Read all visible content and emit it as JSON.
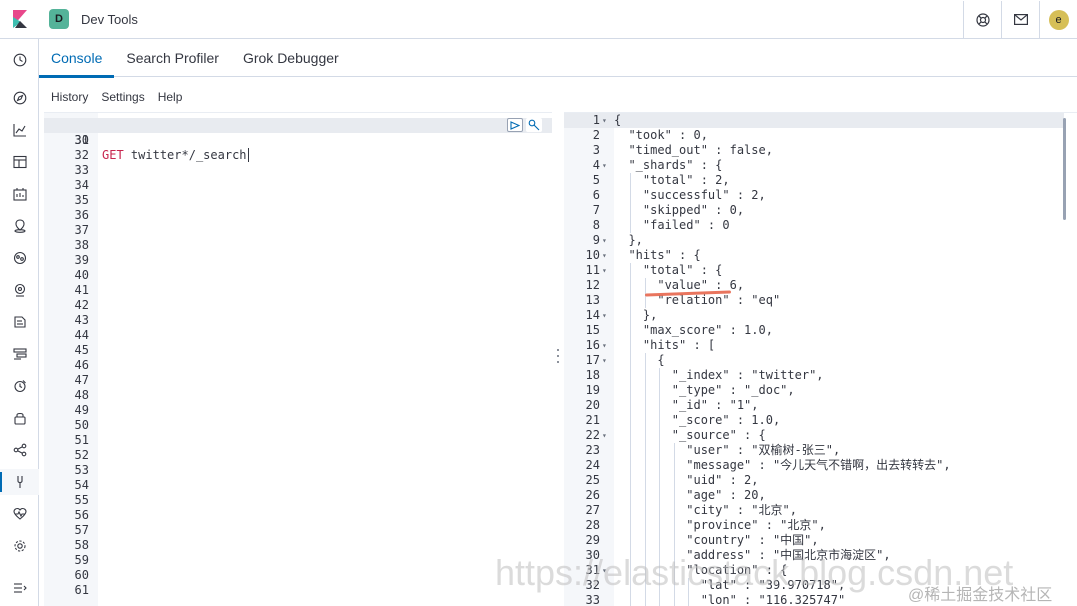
{
  "header": {
    "app_badge": "D",
    "title": "Dev Tools",
    "avatar_letter": "e"
  },
  "tabs": [
    {
      "label": "Console",
      "active": true
    },
    {
      "label": "Search Profiler",
      "active": false
    },
    {
      "label": "Grok Debugger",
      "active": false
    }
  ],
  "submenu": {
    "history": "History",
    "settings": "Settings",
    "help": "Help"
  },
  "request_editor": {
    "top_partial_line_number": "29",
    "first_line": 30,
    "last_line": 61,
    "active_line": 30,
    "method": "GET",
    "url": "twitter*/_search"
  },
  "response_editor": {
    "lines": [
      {
        "n": "1",
        "fold": true,
        "text": "{"
      },
      {
        "n": "2",
        "fold": false,
        "text": "  \"took\" : 0,"
      },
      {
        "n": "3",
        "fold": false,
        "text": "  \"timed_out\" : false,"
      },
      {
        "n": "4",
        "fold": true,
        "text": "  \"_shards\" : {"
      },
      {
        "n": "5",
        "fold": false,
        "text": "    \"total\" : 2,"
      },
      {
        "n": "6",
        "fold": false,
        "text": "    \"successful\" : 2,"
      },
      {
        "n": "7",
        "fold": false,
        "text": "    \"skipped\" : 0,"
      },
      {
        "n": "8",
        "fold": false,
        "text": "    \"failed\" : 0"
      },
      {
        "n": "9",
        "fold": true,
        "text": "  },"
      },
      {
        "n": "10",
        "fold": true,
        "text": "  \"hits\" : {"
      },
      {
        "n": "11",
        "fold": true,
        "text": "    \"total\" : {"
      },
      {
        "n": "12",
        "fold": false,
        "text": "      \"value\" : 6,"
      },
      {
        "n": "13",
        "fold": false,
        "text": "      \"relation\" : \"eq\""
      },
      {
        "n": "14",
        "fold": true,
        "text": "    },"
      },
      {
        "n": "15",
        "fold": false,
        "text": "    \"max_score\" : 1.0,"
      },
      {
        "n": "16",
        "fold": true,
        "text": "    \"hits\" : ["
      },
      {
        "n": "17",
        "fold": true,
        "text": "      {"
      },
      {
        "n": "18",
        "fold": false,
        "text": "        \"_index\" : \"twitter\","
      },
      {
        "n": "19",
        "fold": false,
        "text": "        \"_type\" : \"_doc\","
      },
      {
        "n": "20",
        "fold": false,
        "text": "        \"_id\" : \"1\","
      },
      {
        "n": "21",
        "fold": false,
        "text": "        \"_score\" : 1.0,"
      },
      {
        "n": "22",
        "fold": true,
        "text": "        \"_source\" : {"
      },
      {
        "n": "23",
        "fold": false,
        "text": "          \"user\" : \"双榆树-张三\","
      },
      {
        "n": "24",
        "fold": false,
        "text": "          \"message\" : \"今儿天气不错啊，出去转转去\","
      },
      {
        "n": "25",
        "fold": false,
        "text": "          \"uid\" : 2,"
      },
      {
        "n": "26",
        "fold": false,
        "text": "          \"age\" : 20,"
      },
      {
        "n": "27",
        "fold": false,
        "text": "          \"city\" : \"北京\","
      },
      {
        "n": "28",
        "fold": false,
        "text": "          \"province\" : \"北京\","
      },
      {
        "n": "29",
        "fold": false,
        "text": "          \"country\" : \"中国\","
      },
      {
        "n": "30",
        "fold": false,
        "text": "          \"address\" : \"中国北京市海淀区\","
      },
      {
        "n": "31",
        "fold": true,
        "text": "          \"location\" : {"
      },
      {
        "n": "32",
        "fold": false,
        "text": "            \"lat\" : \"39.970718\","
      },
      {
        "n": "33",
        "fold": false,
        "text": "            \"lon\" : \"116.325747\""
      }
    ]
  },
  "watermark": "https://elasticstack.blog.csdn.net",
  "watermark_credit": "@稀土掘金技术社区",
  "colors": {
    "accent": "#006bb4",
    "annotation": "#e7664c",
    "badge": "#54b399",
    "avatar": "#d6bf57"
  }
}
